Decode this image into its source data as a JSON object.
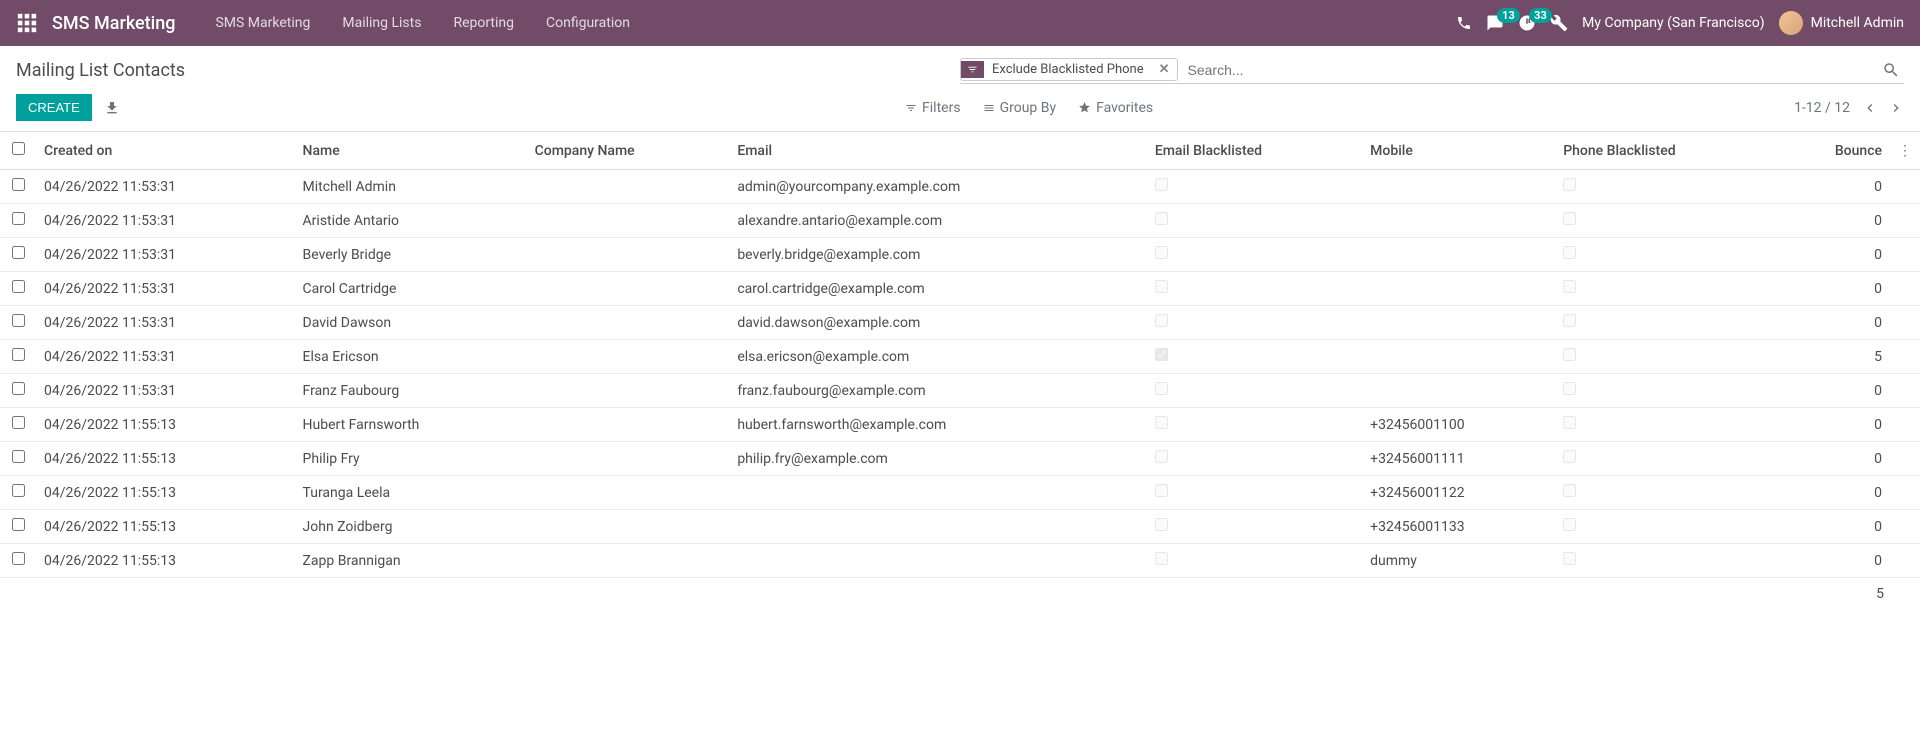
{
  "header": {
    "app_name": "SMS Marketing",
    "nav": [
      "SMS Marketing",
      "Mailing Lists",
      "Reporting",
      "Configuration"
    ],
    "messaging_badge": "13",
    "activity_badge": "33",
    "company": "My Company (San Francisco)",
    "user": "Mitchell Admin"
  },
  "breadcrumb": "Mailing List Contacts",
  "search": {
    "facet_label": "Exclude Blacklisted Phone",
    "placeholder": "Search..."
  },
  "buttons": {
    "create": "CREATE"
  },
  "toolbar": {
    "filters": "Filters",
    "groupby": "Group By",
    "favorites": "Favorites"
  },
  "pager": {
    "range": "1-12 / 12"
  },
  "columns": {
    "created_on": "Created on",
    "name": "Name",
    "company_name": "Company Name",
    "email": "Email",
    "email_blacklisted": "Email Blacklisted",
    "mobile": "Mobile",
    "phone_blacklisted": "Phone Blacklisted",
    "bounce": "Bounce"
  },
  "rows": [
    {
      "created_on": "04/26/2022 11:53:31",
      "name": "Mitchell Admin",
      "company": "",
      "email": "admin@yourcompany.example.com",
      "email_bl": false,
      "mobile": "",
      "phone_bl": false,
      "bounce": "0"
    },
    {
      "created_on": "04/26/2022 11:53:31",
      "name": "Aristide Antario",
      "company": "",
      "email": "alexandre.antario@example.com",
      "email_bl": false,
      "mobile": "",
      "phone_bl": false,
      "bounce": "0"
    },
    {
      "created_on": "04/26/2022 11:53:31",
      "name": "Beverly Bridge",
      "company": "",
      "email": "beverly.bridge@example.com",
      "email_bl": false,
      "mobile": "",
      "phone_bl": false,
      "bounce": "0"
    },
    {
      "created_on": "04/26/2022 11:53:31",
      "name": "Carol Cartridge",
      "company": "",
      "email": "carol.cartridge@example.com",
      "email_bl": false,
      "mobile": "",
      "phone_bl": false,
      "bounce": "0"
    },
    {
      "created_on": "04/26/2022 11:53:31",
      "name": "David Dawson",
      "company": "",
      "email": "david.dawson@example.com",
      "email_bl": false,
      "mobile": "",
      "phone_bl": false,
      "bounce": "0"
    },
    {
      "created_on": "04/26/2022 11:53:31",
      "name": "Elsa Ericson",
      "company": "",
      "email": "elsa.ericson@example.com",
      "email_bl": true,
      "mobile": "",
      "phone_bl": false,
      "bounce": "5"
    },
    {
      "created_on": "04/26/2022 11:53:31",
      "name": "Franz Faubourg",
      "company": "",
      "email": "franz.faubourg@example.com",
      "email_bl": false,
      "mobile": "",
      "phone_bl": false,
      "bounce": "0"
    },
    {
      "created_on": "04/26/2022 11:55:13",
      "name": "Hubert Farnsworth",
      "company": "",
      "email": "hubert.farnsworth@example.com",
      "email_bl": false,
      "mobile": "+32456001100",
      "phone_bl": false,
      "bounce": "0"
    },
    {
      "created_on": "04/26/2022 11:55:13",
      "name": "Philip Fry",
      "company": "",
      "email": "philip.fry@example.com",
      "email_bl": false,
      "mobile": "+32456001111",
      "phone_bl": false,
      "bounce": "0"
    },
    {
      "created_on": "04/26/2022 11:55:13",
      "name": "Turanga Leela",
      "company": "",
      "email": "",
      "email_bl": false,
      "mobile": "+32456001122",
      "phone_bl": false,
      "bounce": "0"
    },
    {
      "created_on": "04/26/2022 11:55:13",
      "name": "John Zoidberg",
      "company": "",
      "email": "",
      "email_bl": false,
      "mobile": "+32456001133",
      "phone_bl": false,
      "bounce": "0"
    },
    {
      "created_on": "04/26/2022 11:55:13",
      "name": "Zapp Brannigan",
      "company": "",
      "email": "",
      "email_bl": false,
      "mobile": "dummy",
      "phone_bl": false,
      "bounce": "0"
    }
  ],
  "footer": {
    "total_bounce": "5"
  }
}
